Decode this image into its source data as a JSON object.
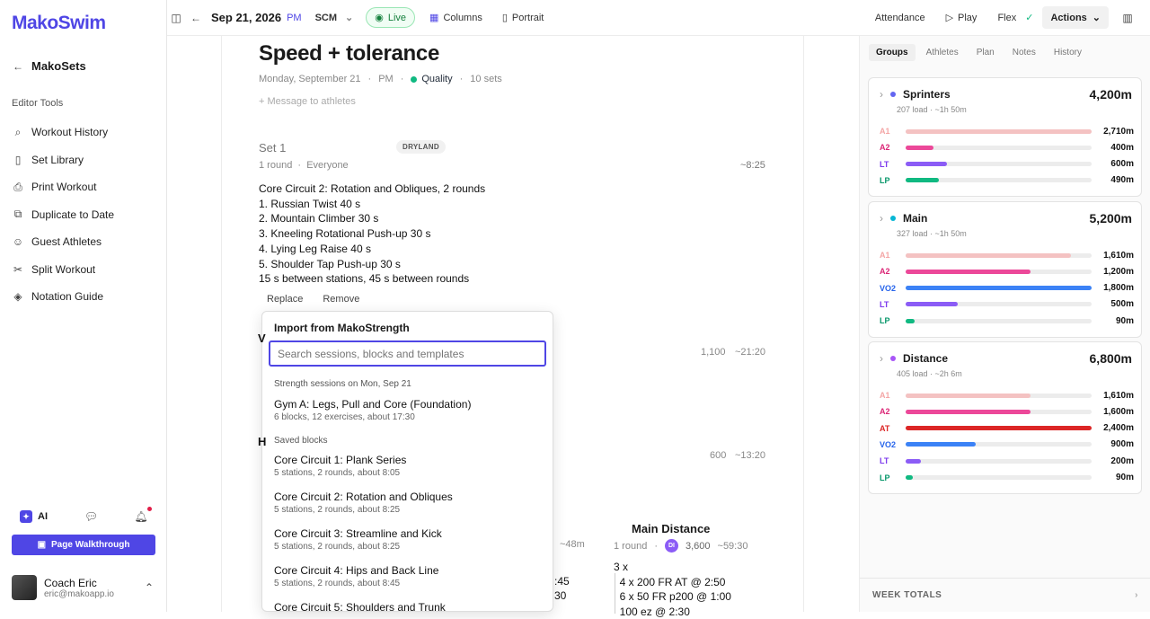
{
  "brand": "MakoSwim",
  "sidebar": {
    "back_label": "MakoSets",
    "section_label": "Editor Tools",
    "items": [
      {
        "label": "Workout History",
        "icon": "search-icon"
      },
      {
        "label": "Set Library",
        "icon": "book-icon"
      },
      {
        "label": "Print Workout",
        "icon": "printer-icon"
      },
      {
        "label": "Duplicate to Date",
        "icon": "copy-icon"
      },
      {
        "label": "Guest Athletes",
        "icon": "user-plus-icon"
      },
      {
        "label": "Split Workout",
        "icon": "scissors-icon"
      },
      {
        "label": "Notation Guide",
        "icon": "graduation-cap-icon"
      }
    ],
    "ai_label": "AI",
    "walkthrough_label": "Page Walkthrough",
    "user": {
      "name": "Coach Eric",
      "email": "eric@makoapp.io"
    }
  },
  "topbar": {
    "date": "Sep 21, 2026",
    "session": "PM",
    "course": "SCM",
    "live": "Live",
    "columns": "Columns",
    "portrait": "Portrait",
    "attendance": "Attendance",
    "play": "Play",
    "flex": "Flex",
    "actions": "Actions"
  },
  "workout": {
    "title": "Speed + tolerance",
    "date": "Monday, September 21",
    "session": "PM",
    "quality": "Quality",
    "sets": "10 sets",
    "message_placeholder": "+ Message to athletes",
    "set1": {
      "label": "Set 1",
      "tag": "DRYLAND",
      "rounds": "1 round",
      "who": "Everyone",
      "time": "~8:25",
      "body": "Core Circuit 2: Rotation and Obliques, 2 rounds\n1. Russian Twist 40 s\n2. Mountain Climber 30 s\n3. Kneeling Rotational Push-up 30 s\n4. Lying Leg Raise 40 s\n5. Shoulder Tap Push-up 30 s\n15 s between stations, 45 s between rounds",
      "replace": "Replace",
      "remove": "Remove"
    },
    "set2": {
      "distance": "1,100",
      "time": "~21:20"
    },
    "set3": {
      "distance": "600",
      "time": "~13:20"
    },
    "lower_time": "~48m",
    "lower_frag1": ":45",
    "lower_frag2": "30",
    "main_distance": {
      "title": "Main Distance",
      "rounds": "1 round",
      "badge": "DI",
      "distance": "3,600",
      "time": "~59:30",
      "body": "3 x\n  4 x 200 FR AT @ 2:50\n  6 x 50 FR p200 @ 1:00\n  100 ez @ 2:30"
    }
  },
  "import_menu": {
    "title": "Import from MakoStrength",
    "search_placeholder": "Search sessions, blocks and templates",
    "section1": "Strength sessions on Mon, Sep 21",
    "section2": "Saved blocks",
    "items": [
      {
        "name": "Gym A: Legs, Pull and Core (Foundation)",
        "desc": "6 blocks, 12 exercises, about 17:30"
      },
      {
        "name": "Core Circuit 1: Plank Series",
        "desc": "5 stations, 2 rounds, about 8:05"
      },
      {
        "name": "Core Circuit 2: Rotation and Obliques",
        "desc": "5 stations, 2 rounds, about 8:25"
      },
      {
        "name": "Core Circuit 3: Streamline and Kick",
        "desc": "5 stations, 2 rounds, about 8:25"
      },
      {
        "name": "Core Circuit 4: Hips and Back Line",
        "desc": "5 stations, 2 rounds, about 8:45"
      },
      {
        "name": "Core Circuit 5: Shoulders and Trunk",
        "desc": ""
      }
    ]
  },
  "right_panel": {
    "tabs": [
      "Groups",
      "Athletes",
      "Plan",
      "Notes",
      "History"
    ],
    "groups": [
      {
        "name": "Sprinters",
        "dot": "#6366f1",
        "total": "4,200m",
        "sub": "207 load · ~1h 50m",
        "bars": [
          {
            "label": "A1",
            "color": "#f4c2c2",
            "lcolor": "#f4a6a6",
            "value": "2,710m",
            "fraction": 1.0
          },
          {
            "label": "A2",
            "color": "#ec4899",
            "lcolor": "#db2777",
            "value": "400m",
            "fraction": 0.15
          },
          {
            "label": "LT",
            "color": "#8b5cf6",
            "lcolor": "#7c3aed",
            "value": "600m",
            "fraction": 0.22
          },
          {
            "label": "LP",
            "color": "#10b981",
            "lcolor": "#059669",
            "value": "490m",
            "fraction": 0.18
          }
        ]
      },
      {
        "name": "Main",
        "dot": "#06b6d4",
        "total": "5,200m",
        "sub": "327 load · ~1h 50m",
        "bars": [
          {
            "label": "A1",
            "color": "#f4c2c2",
            "lcolor": "#f4a6a6",
            "value": "1,610m",
            "fraction": 0.89
          },
          {
            "label": "A2",
            "color": "#ec4899",
            "lcolor": "#db2777",
            "value": "1,200m",
            "fraction": 0.67
          },
          {
            "label": "VO2",
            "color": "#3b82f6",
            "lcolor": "#2563eb",
            "value": "1,800m",
            "fraction": 1.0
          },
          {
            "label": "LT",
            "color": "#8b5cf6",
            "lcolor": "#7c3aed",
            "value": "500m",
            "fraction": 0.28
          },
          {
            "label": "LP",
            "color": "#10b981",
            "lcolor": "#059669",
            "value": "90m",
            "fraction": 0.05
          }
        ]
      },
      {
        "name": "Distance",
        "dot": "#a855f7",
        "total": "6,800m",
        "sub": "405 load · ~2h 6m",
        "bars": [
          {
            "label": "A1",
            "color": "#f4c2c2",
            "lcolor": "#f4a6a6",
            "value": "1,610m",
            "fraction": 0.67
          },
          {
            "label": "A2",
            "color": "#ec4899",
            "lcolor": "#db2777",
            "value": "1,600m",
            "fraction": 0.67
          },
          {
            "label": "AT",
            "color": "#dc2626",
            "lcolor": "#dc2626",
            "value": "2,400m",
            "fraction": 1.0
          },
          {
            "label": "VO2",
            "color": "#3b82f6",
            "lcolor": "#2563eb",
            "value": "900m",
            "fraction": 0.375
          },
          {
            "label": "LT",
            "color": "#8b5cf6",
            "lcolor": "#7c3aed",
            "value": "200m",
            "fraction": 0.083
          },
          {
            "label": "LP",
            "color": "#10b981",
            "lcolor": "#059669",
            "value": "90m",
            "fraction": 0.0375
          }
        ]
      }
    ],
    "week_totals": "WEEK TOTALS"
  }
}
